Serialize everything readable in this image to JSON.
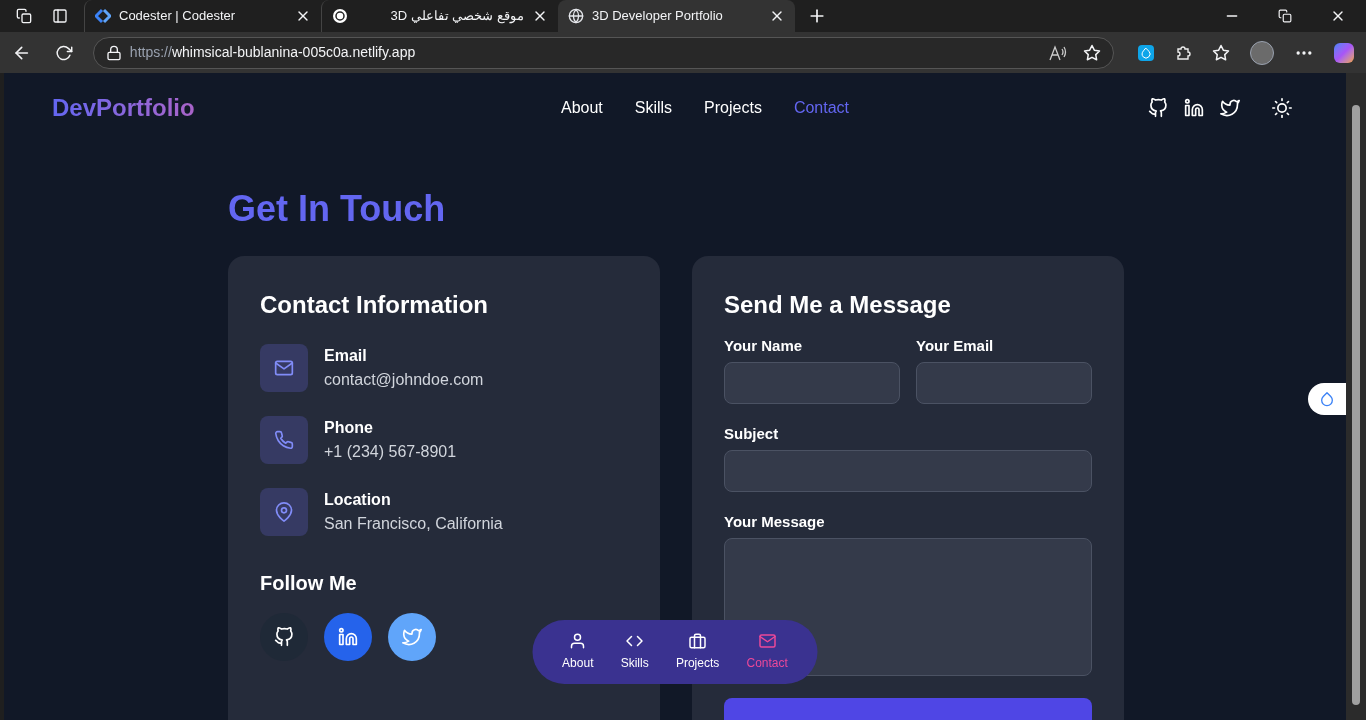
{
  "browser": {
    "tabs": [
      {
        "title": "Codester | Codester",
        "kind": "codester",
        "selected": false
      },
      {
        "title": "موقع شخصي تفاعلي 3D",
        "kind": "openai",
        "selected": false
      },
      {
        "title": "3D Developer Portfolio",
        "kind": "globe",
        "selected": true
      }
    ],
    "url": {
      "scheme": "https://",
      "host": "whimsical-bublanina-005c0a.netlify.app"
    }
  },
  "header": {
    "logo": "DevPortfolio",
    "nav": [
      {
        "label": "About",
        "selected": false
      },
      {
        "label": "Skills",
        "selected": false
      },
      {
        "label": "Projects",
        "selected": false
      },
      {
        "label": "Contact",
        "selected": true
      }
    ]
  },
  "section_title": "Get In Touch",
  "contact_info": {
    "title": "Contact Information",
    "items": [
      {
        "kind": "email",
        "label": "Email",
        "value": "contact@johndoe.com"
      },
      {
        "kind": "phone",
        "label": "Phone",
        "value": "+1 (234) 567-8901"
      },
      {
        "kind": "location",
        "label": "Location",
        "value": "San Francisco, California"
      }
    ],
    "follow_title": "Follow Me",
    "socials": [
      {
        "kind": "github"
      },
      {
        "kind": "linkedin"
      },
      {
        "kind": "twitter"
      }
    ]
  },
  "form": {
    "title": "Send Me a Message",
    "fields": [
      {
        "label": "Your Name",
        "kind": "half"
      },
      {
        "label": "Your Email",
        "kind": "half"
      },
      {
        "label": "Subject",
        "kind": "full"
      },
      {
        "label": "Your Message",
        "kind": "textarea"
      }
    ]
  },
  "bottom_nav": [
    {
      "label": "About",
      "kind": "user",
      "selected": false
    },
    {
      "label": "Skills",
      "kind": "code",
      "selected": false
    },
    {
      "label": "Projects",
      "kind": "briefcase",
      "selected": false
    },
    {
      "label": "Contact",
      "kind": "mail",
      "selected": true
    }
  ]
}
